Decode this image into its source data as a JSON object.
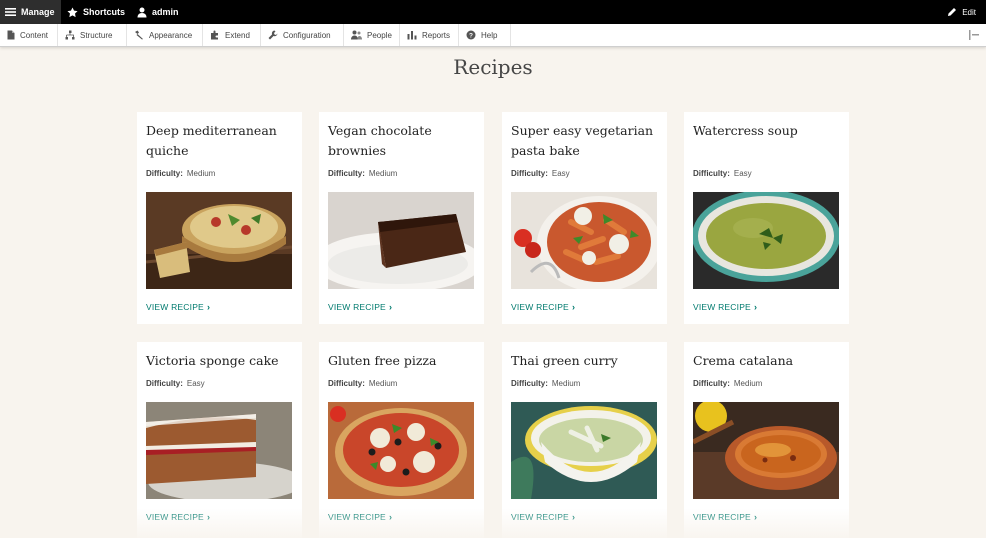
{
  "toolbar": {
    "manage": "Manage",
    "shortcuts": "Shortcuts",
    "user": "admin",
    "edit": "Edit"
  },
  "menu": {
    "items": [
      {
        "label": "Content",
        "icon": "content-icon"
      },
      {
        "label": "Structure",
        "icon": "structure-icon"
      },
      {
        "label": "Appearance",
        "icon": "appearance-icon"
      },
      {
        "label": "Extend",
        "icon": "extend-icon"
      },
      {
        "label": "Configuration",
        "icon": "configuration-icon"
      },
      {
        "label": "People",
        "icon": "people-icon"
      },
      {
        "label": "Reports",
        "icon": "reports-icon"
      },
      {
        "label": "Help",
        "icon": "help-icon"
      }
    ]
  },
  "page": {
    "title": "Recipes"
  },
  "recipes": [
    {
      "title": "Deep mediterranean quiche",
      "difficulty_label": "Difficulty:",
      "difficulty": "Medium",
      "link": "VIEW RECIPE"
    },
    {
      "title": "Vegan chocolate brownies",
      "difficulty_label": "Difficulty:",
      "difficulty": "Medium",
      "link": "VIEW RECIPE"
    },
    {
      "title": "Super easy vegetarian pasta bake",
      "difficulty_label": "Difficulty:",
      "difficulty": "Easy",
      "link": "VIEW RECIPE"
    },
    {
      "title": "Watercress soup",
      "difficulty_label": "Difficulty:",
      "difficulty": "Easy",
      "link": "VIEW RECIPE"
    },
    {
      "title": "Victoria sponge cake",
      "difficulty_label": "Difficulty:",
      "difficulty": "Easy",
      "link": "VIEW RECIPE"
    },
    {
      "title": "Gluten free pizza",
      "difficulty_label": "Difficulty:",
      "difficulty": "Medium",
      "link": "VIEW RECIPE"
    },
    {
      "title": "Thai green curry",
      "difficulty_label": "Difficulty:",
      "difficulty": "Medium",
      "link": "VIEW RECIPE"
    },
    {
      "title": "Crema catalana",
      "difficulty_label": "Difficulty:",
      "difficulty": "Medium",
      "link": "VIEW RECIPE"
    }
  ],
  "colors": {
    "link": "#007a6e",
    "toolbar": "#000000",
    "background": "#f8f4ee"
  }
}
